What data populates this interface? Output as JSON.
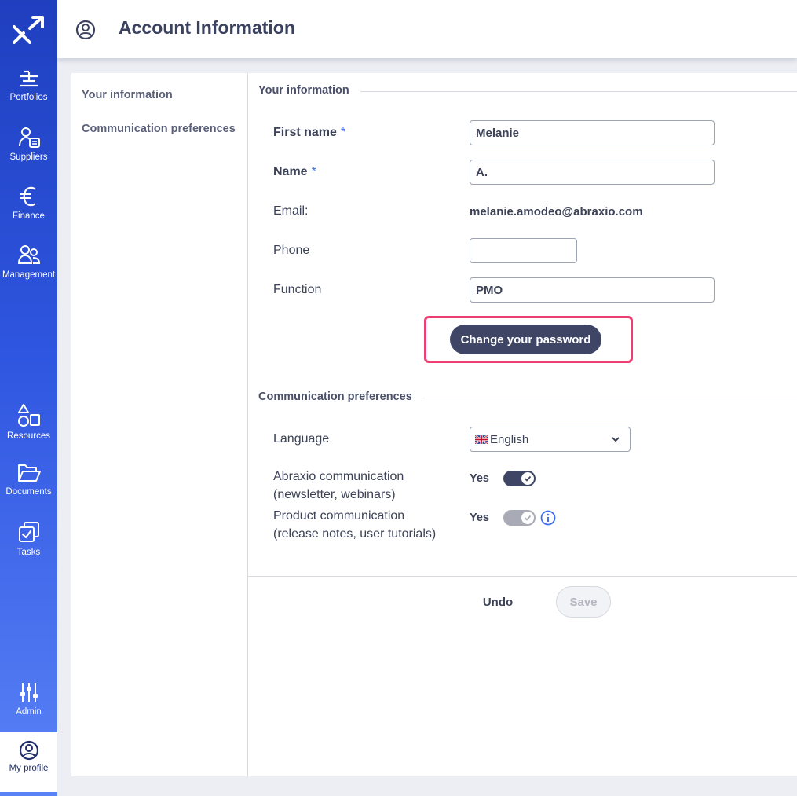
{
  "sidebar": {
    "logo_icon": "abraxio-logo-icon",
    "items": [
      {
        "label": "Portfolios",
        "icon": "portfolio-bars-icon"
      },
      {
        "label": "Suppliers",
        "icon": "supplier-user-icon"
      },
      {
        "label": "Finance",
        "icon": "euro-icon"
      },
      {
        "label": "Management",
        "icon": "users-icon"
      },
      {
        "label": "Resources",
        "icon": "shapes-icon"
      },
      {
        "label": "Documents",
        "icon": "folder-open-icon"
      },
      {
        "label": "Tasks",
        "icon": "tasks-check-icon"
      },
      {
        "label": "Admin",
        "icon": "sliders-icon"
      },
      {
        "label": "My profile",
        "icon": "user-circle-icon"
      }
    ]
  },
  "header": {
    "title": "Account Information",
    "icon": "user-circle-icon"
  },
  "side_menu": {
    "items": [
      "Your information",
      "Communication preferences"
    ]
  },
  "your_information": {
    "section_title": "Your information",
    "first_name": {
      "label": "First name",
      "required": "*",
      "value": "Melanie"
    },
    "name": {
      "label": "Name",
      "required": "*",
      "value": "A."
    },
    "email": {
      "label": "Email:",
      "value": "melanie.amodeo@abraxio.com"
    },
    "phone": {
      "label": "Phone",
      "value": ""
    },
    "function": {
      "label": "Function",
      "value": "PMO"
    },
    "change_password_label": "Change your password"
  },
  "communication_preferences": {
    "section_title": "Communication preferences",
    "language": {
      "label": "Language",
      "value": "English",
      "flag_icon": "uk-flag-icon"
    },
    "abraxio_communication": {
      "label_line1": "Abraxio communication",
      "label_line2": "(newsletter, webinars)",
      "value": "Yes",
      "enabled": true
    },
    "product_communication": {
      "label_line1": "Product communication",
      "label_line2": "(release notes, user tutorials)",
      "value": "Yes",
      "disabled": true,
      "info_icon": "info-icon"
    }
  },
  "footer": {
    "undo_label": "Undo",
    "save_label": "Save"
  },
  "colors": {
    "sidebar_top": "#1f3fbf",
    "sidebar_bottom": "#5a82f7",
    "primary_button": "#3f4665",
    "highlight_border": "#ec3f74",
    "required_mark": "#3d6ff0"
  }
}
